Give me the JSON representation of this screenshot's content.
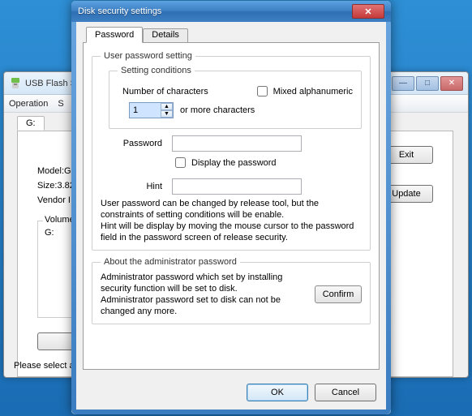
{
  "bg": {
    "title": "USB Flash S",
    "menu": {
      "operation": "Operation",
      "s": "S"
    },
    "driveTab": "G:",
    "info": {
      "model": "Model:Ge",
      "size": "Size:3.82",
      "vendor": "Vendor I"
    },
    "volumeGroup": "Volume",
    "volumeDrive": "G:",
    "exit": "Exit",
    "update": "Update",
    "status": "Please select a c"
  },
  "dlg": {
    "title": "Disk security settings",
    "tabs": {
      "password": "Password",
      "details": "Details"
    },
    "userGroup": "User password setting",
    "condGroup": "Setting conditions",
    "numCharsLabel": "Number of characters",
    "numCharsValue": "1",
    "orMore": "or more characters",
    "mixedAlpha": "Mixed alphanumeric",
    "passwordLabel": "Password",
    "displayPw": "Display the password",
    "hintLabel": "Hint",
    "helpText": "User password can be changed by release tool, but the constraints of setting conditions will be enable.\nHint will be display by moving the mouse cursor to the password field in the password screen of release security.",
    "adminGroup": "About the administrator password",
    "adminText": "Administrator password which set by installing security function will be set to disk.\nAdministrator password set to disk can not be changed any more.",
    "confirm": "Confirm",
    "ok": "OK",
    "cancel": "Cancel"
  }
}
